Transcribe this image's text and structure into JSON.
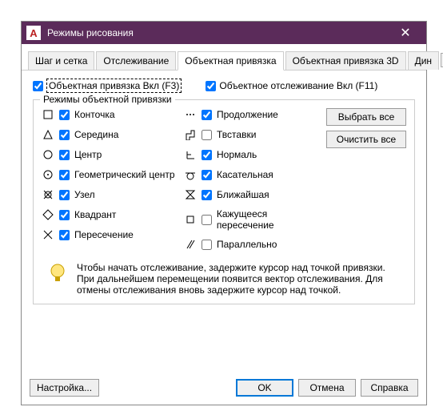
{
  "titlebar": {
    "app_icon_letter": "A",
    "title": "Режимы рисования",
    "close": "✕"
  },
  "tabs": {
    "t0": "Шаг и сетка",
    "t1": "Отслеживание",
    "t2": "Объектная привязка",
    "t3": "Объектная привязка 3D",
    "t4": "Дин",
    "left": "◂",
    "right": "▸"
  },
  "top": {
    "osnap_label": "Объектная привязка Вкл (F3)",
    "otrack_label": "Объектное отслеживание Вкл (F11)"
  },
  "group": {
    "title": "Режимы объектной привязки",
    "left": {
      "r0": "Конточка",
      "r1": "Середина",
      "r2": "Центр",
      "r3": "Геометрический центр",
      "r4": "Узел",
      "r5": "Квадрант",
      "r6": "Пересечение"
    },
    "right": {
      "r0": "Продолжение",
      "r1": "Твставки",
      "r2": "Нормаль",
      "r3": "Касательная",
      "r4": "Ближайшая",
      "r5": "Кажущееся пересечение",
      "r6": "Параллельно"
    },
    "btn_all": "Выбрать все",
    "btn_clear": "Очистить все"
  },
  "tip": "Чтобы начать отслеживание, задержите курсор над точкой привязки. При дальнейшем перемещении появится вектор отслеживания. Для отмены отслеживания вновь задержите курсор над точкой.",
  "footer": {
    "options": "Настройка...",
    "ok": "OK",
    "cancel": "Отмена",
    "help": "Справка"
  }
}
